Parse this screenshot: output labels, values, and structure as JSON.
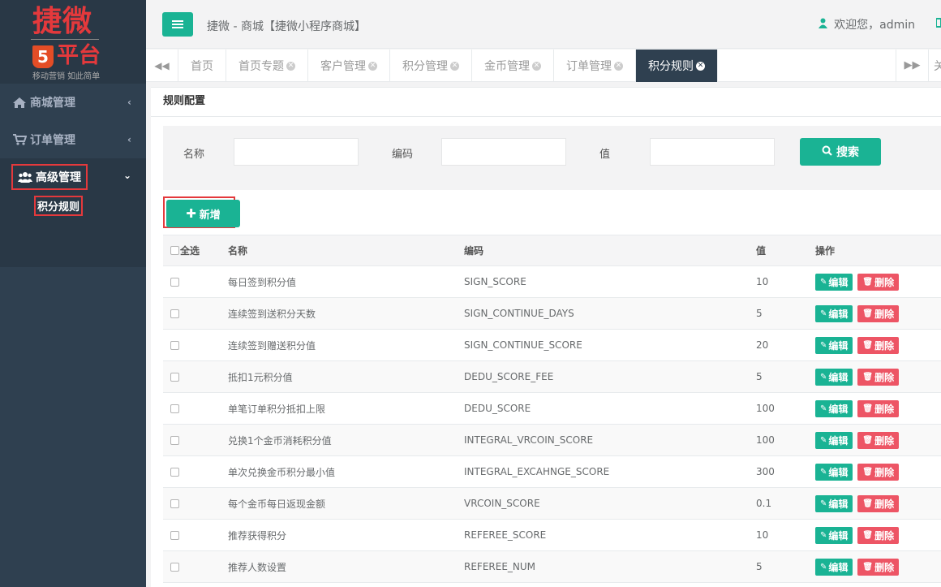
{
  "logo": {
    "title": "捷微",
    "badge": "5",
    "sub": "平台",
    "slogan": "移动营销 如此简单"
  },
  "sidebar": {
    "items": [
      {
        "label": "商城管理",
        "icon": "home-icon"
      },
      {
        "label": "订单管理",
        "icon": "cart-icon"
      },
      {
        "label": "高级管理",
        "icon": "users-icon"
      }
    ],
    "subitems": [
      {
        "label": "积分规则"
      }
    ]
  },
  "header": {
    "title": "捷微 - 商城【捷微小程序商城】",
    "welcome": "欢迎您，admin"
  },
  "tabs": [
    {
      "label": "首页",
      "closable": false
    },
    {
      "label": "首页专题",
      "closable": true
    },
    {
      "label": "客户管理",
      "closable": true
    },
    {
      "label": "积分管理",
      "closable": true
    },
    {
      "label": "金币管理",
      "closable": true
    },
    {
      "label": "订单管理",
      "closable": true
    },
    {
      "label": "积分规则",
      "closable": true
    }
  ],
  "tab_close_all": "关",
  "panel": {
    "title": "规则配置"
  },
  "search": {
    "name_label": "名称",
    "code_label": "编码",
    "value_label": "值",
    "button": "搜索"
  },
  "toolbar": {
    "add_label": "新增"
  },
  "table": {
    "headers": {
      "select_all": "全选",
      "name": "名称",
      "code": "编码",
      "value": "值",
      "actions": "操作"
    },
    "edit_label": "编辑",
    "delete_label": "删除",
    "rows": [
      {
        "name": "每日签到积分值",
        "code": "SIGN_SCORE",
        "value": "10"
      },
      {
        "name": "连续签到送积分天数",
        "code": "SIGN_CONTINUE_DAYS",
        "value": "5"
      },
      {
        "name": "连续签到赠送积分值",
        "code": "SIGN_CONTINUE_SCORE",
        "value": "20"
      },
      {
        "name": "抵扣1元积分值",
        "code": "DEDU_SCORE_FEE",
        "value": "5"
      },
      {
        "name": "单笔订单积分抵扣上限",
        "code": "DEDU_SCORE",
        "value": "100"
      },
      {
        "name": "兑换1个金币消耗积分值",
        "code": "INTEGRAL_VRCOIN_SCORE",
        "value": "100"
      },
      {
        "name": "单次兑换金币积分最小值",
        "code": "INTEGRAL_EXCAHNGE_SCORE",
        "value": "300"
      },
      {
        "name": "每个金币每日返现金额",
        "code": "VRCOIN_SCORE",
        "value": "0.1"
      },
      {
        "name": "推荐获得积分",
        "code": "REFEREE_SCORE",
        "value": "10"
      },
      {
        "name": "推荐人数设置",
        "code": "REFEREE_NUM",
        "value": "5"
      }
    ]
  },
  "colors": {
    "sidebar": "#2f4050",
    "sidebar_dark": "#293846",
    "primary": "#1ab394",
    "danger": "#ed5565",
    "highlight": "#e4393c"
  }
}
